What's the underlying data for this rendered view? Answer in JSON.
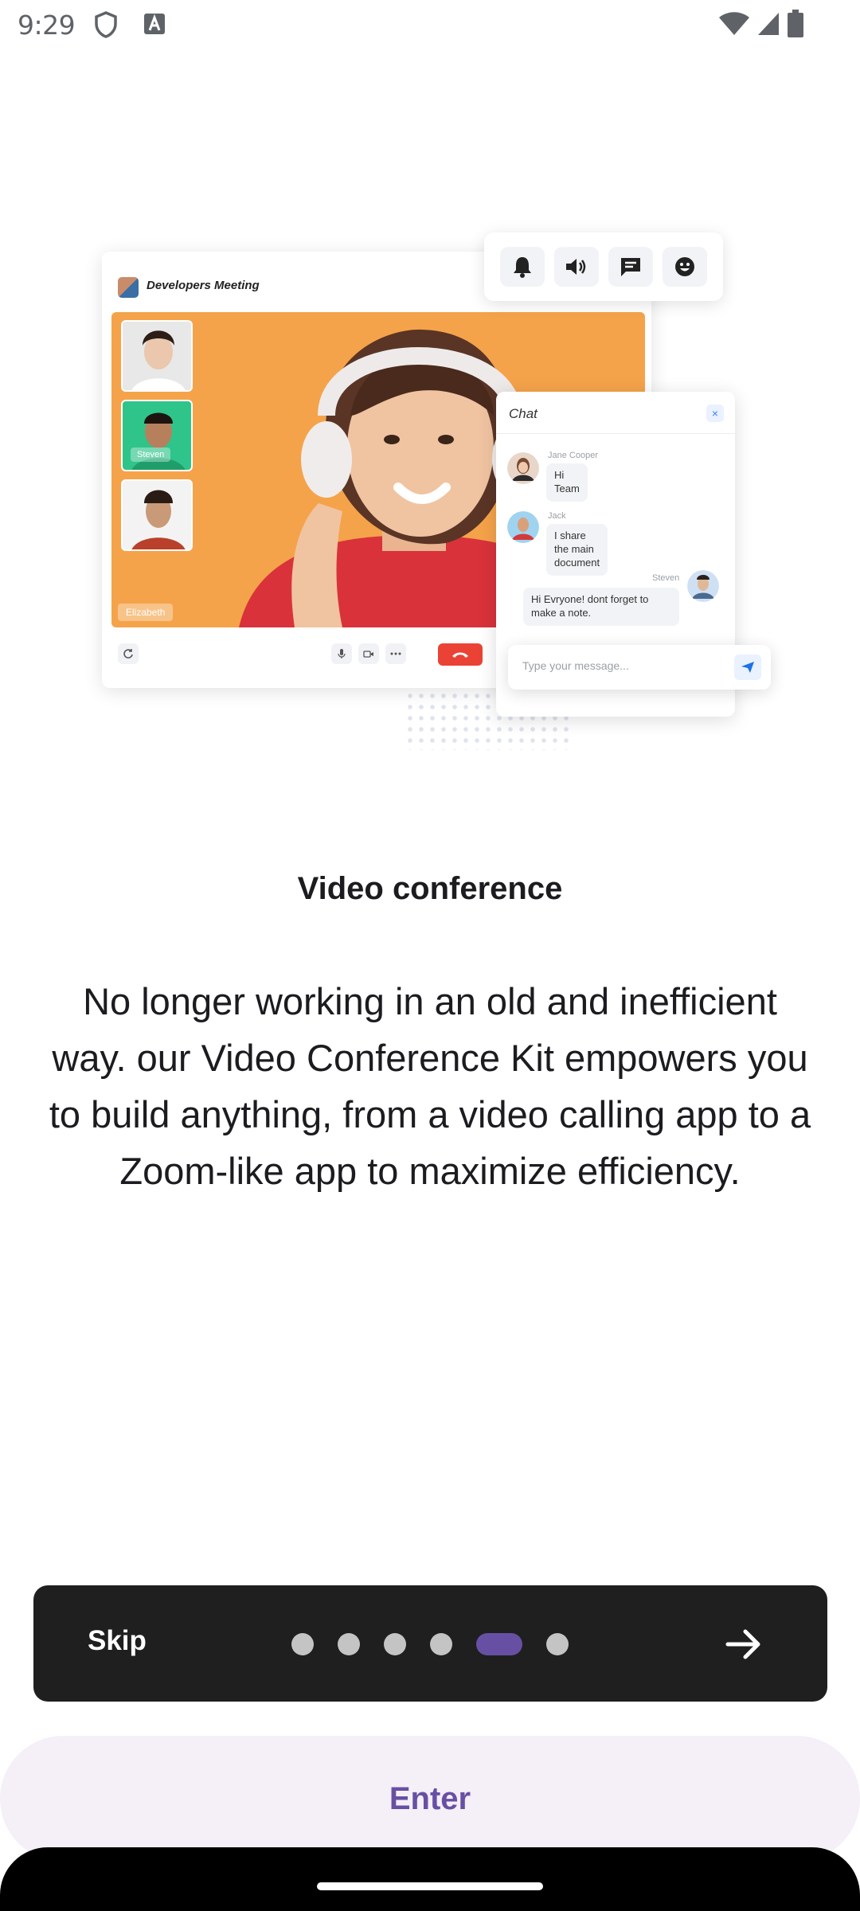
{
  "status_bar": {
    "time": "9:29",
    "left_icons": [
      "shield-icon",
      "font-a-icon"
    ],
    "right_icons": [
      "wifi-icon",
      "signal-icon",
      "battery-icon"
    ]
  },
  "illustration": {
    "meeting_title": "Developers Meeting",
    "main_participant": "Elizabeth",
    "thumbnails": [
      "",
      "Steven",
      ""
    ],
    "toolbar_icons": [
      "notification-bell-icon",
      "speaker-icon",
      "message-icon",
      "emoji-icon"
    ],
    "chat": {
      "title": "Chat",
      "close": "×",
      "messages": [
        {
          "name": "Jane Cooper",
          "text": "Hi Team"
        },
        {
          "name": "Jack",
          "text": "I share the main document"
        },
        {
          "name": "Steven",
          "text": "Hi Evryone! dont forget to make a note."
        }
      ],
      "input_placeholder": "Type your message..."
    }
  },
  "onboarding": {
    "title": "Video conference",
    "description": "No longer working in an old and inefficient way. our Video Conference Kit empowers you to build anything, from a video calling app to a Zoom-like app to maximize efficiency."
  },
  "nav": {
    "skip_label": "Skip",
    "page_count": 6,
    "current_page": 5,
    "next_icon": "arrow-right-icon"
  },
  "enter_label": "Enter",
  "colors": {
    "accent": "#6750a4",
    "nav_background": "#1f1f1f",
    "enter_background": "#f5eff7",
    "video_background": "#f5a34a"
  }
}
